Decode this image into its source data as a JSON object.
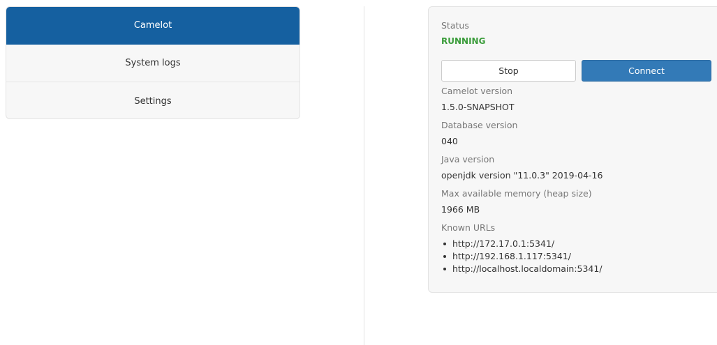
{
  "nav": {
    "items": [
      {
        "label": "Camelot",
        "active": true
      },
      {
        "label": "System logs",
        "active": false
      },
      {
        "label": "Settings",
        "active": false
      }
    ],
    "active_color": "#1560a0"
  },
  "status": {
    "status_label": "Status",
    "status_value": "RUNNING",
    "status_color": "#3a9c3a",
    "stop_label": "Stop",
    "connect_label": "Connect",
    "connect_color": "#337ab7",
    "camelot_version_label": "Camelot version",
    "camelot_version_value": "1.5.0-SNAPSHOT",
    "database_version_label": "Database version",
    "database_version_value": "040",
    "java_version_label": "Java version",
    "java_version_value": "openjdk version \"11.0.3\" 2019-04-16",
    "max_memory_label": "Max available memory (heap size)",
    "max_memory_value": "1966 MB",
    "known_urls_label": "Known URLs",
    "known_urls": [
      "http://172.17.0.1:5341/",
      "http://192.168.1.117:5341/",
      "http://localhost.localdomain:5341/"
    ]
  }
}
